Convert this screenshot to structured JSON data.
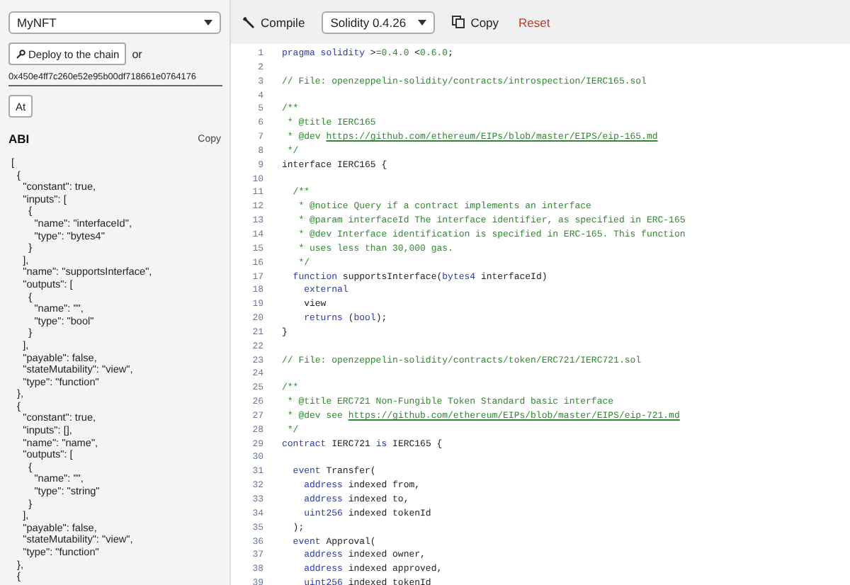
{
  "sidebar": {
    "contract_select": {
      "value": "MyNFT"
    },
    "deploy_button": {
      "label": "Deploy to the chain"
    },
    "or_text": "or",
    "address_field": {
      "value": "0x450e4ff7c260e52e95b00df718661e0764176"
    },
    "at_button": {
      "label": "At"
    },
    "abi": {
      "title": "ABI",
      "copy": "Copy",
      "text": "[\n  {\n    \"constant\": true,\n    \"inputs\": [\n      {\n        \"name\": \"interfaceId\",\n        \"type\": \"bytes4\"\n      }\n    ],\n    \"name\": \"supportsInterface\",\n    \"outputs\": [\n      {\n        \"name\": \"\",\n        \"type\": \"bool\"\n      }\n    ],\n    \"payable\": false,\n    \"stateMutability\": \"view\",\n    \"type\": \"function\"\n  },\n  {\n    \"constant\": true,\n    \"inputs\": [],\n    \"name\": \"name\",\n    \"outputs\": [\n      {\n        \"name\": \"\",\n        \"type\": \"string\"\n      }\n    ],\n    \"payable\": false,\n    \"stateMutability\": \"view\",\n    \"type\": \"function\"\n  },\n  {"
    }
  },
  "toolbar": {
    "compile": "Compile",
    "compiler_select": {
      "value": "Solidity 0.4.26"
    },
    "copy": "Copy",
    "reset": "Reset"
  },
  "editor": {
    "lines": [
      {
        "number": "1",
        "tokens": [
          {
            "kind": "kw",
            "text": "pragma solidity"
          },
          {
            "kind": "plain",
            "text": " >="
          },
          {
            "kind": "num",
            "text": "0.4.0"
          },
          {
            "kind": "plain",
            "text": " <"
          },
          {
            "kind": "num",
            "text": "0.6.0"
          },
          {
            "kind": "plain",
            "text": ";"
          }
        ]
      },
      {
        "number": "2"
      },
      {
        "number": "3",
        "tokens": [
          {
            "kind": "comment",
            "text": "// File: openzeppelin-solidity/contracts/introspection/IERC165.sol"
          }
        ]
      },
      {
        "number": "4"
      },
      {
        "number": "5",
        "tokens": [
          {
            "kind": "comment",
            "text": "/**"
          }
        ]
      },
      {
        "number": "6",
        "tokens": [
          {
            "kind": "comment",
            "text": " * @title IERC165"
          }
        ]
      },
      {
        "number": "7",
        "tokens": [
          {
            "kind": "comment",
            "text": " * @dev "
          },
          {
            "kind": "link",
            "text": "https://github.com/ethereum/EIPs/blob/master/EIPS/eip-165.md"
          }
        ]
      },
      {
        "number": "8",
        "tokens": [
          {
            "kind": "comment",
            "text": " */"
          }
        ]
      },
      {
        "number": "9",
        "tokens": [
          {
            "kind": "plain",
            "text": "interface IERC165 {"
          }
        ]
      },
      {
        "number": "10"
      },
      {
        "number": "11",
        "tokens": [
          {
            "kind": "comment",
            "text": "  /**"
          }
        ]
      },
      {
        "number": "12",
        "tokens": [
          {
            "kind": "comment",
            "text": "   * @notice Query if a contract implements an interface"
          }
        ]
      },
      {
        "number": "13",
        "tokens": [
          {
            "kind": "comment",
            "text": "   * @param interfaceId The interface identifier, as specified in ERC-165"
          }
        ]
      },
      {
        "number": "14",
        "tokens": [
          {
            "kind": "comment",
            "text": "   * @dev Interface identification is specified in ERC-165. This function"
          }
        ]
      },
      {
        "number": "15",
        "tokens": [
          {
            "kind": "comment",
            "text": "   * uses less than 30,000 gas."
          }
        ]
      },
      {
        "number": "16",
        "tokens": [
          {
            "kind": "comment",
            "text": "   */"
          }
        ]
      },
      {
        "number": "17",
        "tokens": [
          {
            "kind": "kw",
            "text": "  function"
          },
          {
            "kind": "plain",
            "text": " supportsInterface("
          },
          {
            "kind": "kw",
            "text": "bytes4"
          },
          {
            "kind": "plain",
            "text": " interfaceId)"
          }
        ]
      },
      {
        "number": "18",
        "tokens": [
          {
            "kind": "kw",
            "text": "    external"
          }
        ]
      },
      {
        "number": "19",
        "tokens": [
          {
            "kind": "plain",
            "text": "    view"
          }
        ]
      },
      {
        "number": "20",
        "tokens": [
          {
            "kind": "kw",
            "text": "    returns"
          },
          {
            "kind": "plain",
            "text": " ("
          },
          {
            "kind": "kw",
            "text": "bool"
          },
          {
            "kind": "plain",
            "text": ");"
          }
        ]
      },
      {
        "number": "21",
        "tokens": [
          {
            "kind": "plain",
            "text": "}"
          }
        ]
      },
      {
        "number": "22"
      },
      {
        "number": "23",
        "tokens": [
          {
            "kind": "comment",
            "text": "// File: openzeppelin-solidity/contracts/token/ERC721/IERC721.sol"
          }
        ]
      },
      {
        "number": "24"
      },
      {
        "number": "25",
        "tokens": [
          {
            "kind": "comment",
            "text": "/**"
          }
        ]
      },
      {
        "number": "26",
        "tokens": [
          {
            "kind": "comment",
            "text": " * @title ERC721 Non-Fungible Token Standard basic interface"
          }
        ]
      },
      {
        "number": "27",
        "tokens": [
          {
            "kind": "comment",
            "text": " * @dev see "
          },
          {
            "kind": "link",
            "text": "https://github.com/ethereum/EIPs/blob/master/EIPS/eip-721.md"
          }
        ]
      },
      {
        "number": "28",
        "tokens": [
          {
            "kind": "comment",
            "text": " */"
          }
        ]
      },
      {
        "number": "29",
        "tokens": [
          {
            "kind": "kw",
            "text": "contract"
          },
          {
            "kind": "plain",
            "text": " IERC721 "
          },
          {
            "kind": "kw",
            "text": "is"
          },
          {
            "kind": "plain",
            "text": " IERC165 {"
          }
        ]
      },
      {
        "number": "30"
      },
      {
        "number": "31",
        "tokens": [
          {
            "kind": "kw",
            "text": "  event"
          },
          {
            "kind": "plain",
            "text": " Transfer("
          }
        ]
      },
      {
        "number": "32",
        "tokens": [
          {
            "kind": "kw",
            "text": "    address"
          },
          {
            "kind": "plain",
            "text": " indexed from,"
          }
        ]
      },
      {
        "number": "33",
        "tokens": [
          {
            "kind": "kw",
            "text": "    address"
          },
          {
            "kind": "plain",
            "text": " indexed to,"
          }
        ]
      },
      {
        "number": "34",
        "tokens": [
          {
            "kind": "kw",
            "text": "    uint256"
          },
          {
            "kind": "plain",
            "text": " indexed tokenId"
          }
        ]
      },
      {
        "number": "35",
        "tokens": [
          {
            "kind": "plain",
            "text": "  );"
          }
        ]
      },
      {
        "number": "36",
        "tokens": [
          {
            "kind": "kw",
            "text": "  event"
          },
          {
            "kind": "plain",
            "text": " Approval("
          }
        ]
      },
      {
        "number": "37",
        "tokens": [
          {
            "kind": "kw",
            "text": "    address"
          },
          {
            "kind": "plain",
            "text": " indexed owner,"
          }
        ]
      },
      {
        "number": "38",
        "tokens": [
          {
            "kind": "kw",
            "text": "    address"
          },
          {
            "kind": "plain",
            "text": " indexed approved,"
          }
        ]
      },
      {
        "number": "39",
        "tokens": [
          {
            "kind": "kw",
            "text": "    uint256"
          },
          {
            "kind": "plain",
            "text": " indexed tokenId"
          }
        ]
      }
    ]
  }
}
